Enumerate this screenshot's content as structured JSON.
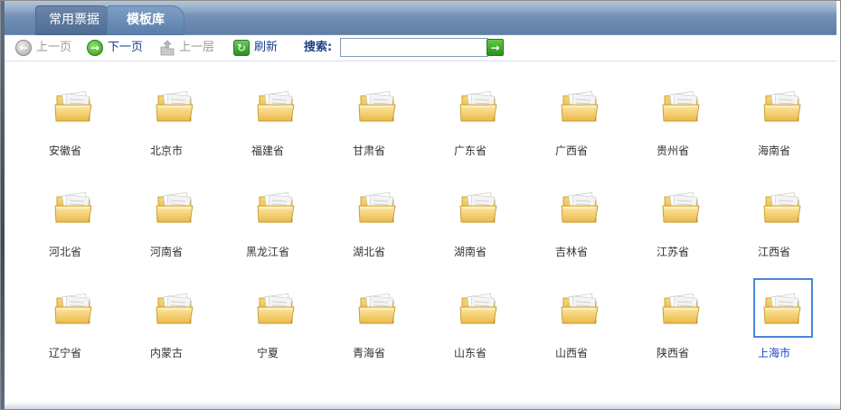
{
  "tabs": [
    {
      "label": "常用票据",
      "active": false
    },
    {
      "label": "模板库",
      "active": true
    }
  ],
  "toolbar": {
    "prev_page": "上一页",
    "next_page": "下一页",
    "up_level": "上一层",
    "refresh": "刷新",
    "search_label": "搜索:",
    "search_value": "",
    "search_placeholder": ""
  },
  "folders": [
    {
      "label": "安徽省"
    },
    {
      "label": "北京市"
    },
    {
      "label": "福建省"
    },
    {
      "label": "甘肃省"
    },
    {
      "label": "广东省"
    },
    {
      "label": "广西省"
    },
    {
      "label": "贵州省"
    },
    {
      "label": "海南省"
    },
    {
      "label": "河北省"
    },
    {
      "label": "河南省"
    },
    {
      "label": "黑龙江省"
    },
    {
      "label": "湖北省"
    },
    {
      "label": "湖南省"
    },
    {
      "label": "吉林省"
    },
    {
      "label": "江苏省"
    },
    {
      "label": "江西省"
    },
    {
      "label": "辽宁省"
    },
    {
      "label": "内蒙古"
    },
    {
      "label": "宁夏"
    },
    {
      "label": "青海省"
    },
    {
      "label": "山东省"
    },
    {
      "label": "山西省"
    },
    {
      "label": "陕西省"
    },
    {
      "label": "上海市",
      "selected": true
    }
  ],
  "colors": {
    "selection_border": "#4a86d8",
    "link_text": "#1b3f8a",
    "tabbar": "#6f8db3"
  }
}
